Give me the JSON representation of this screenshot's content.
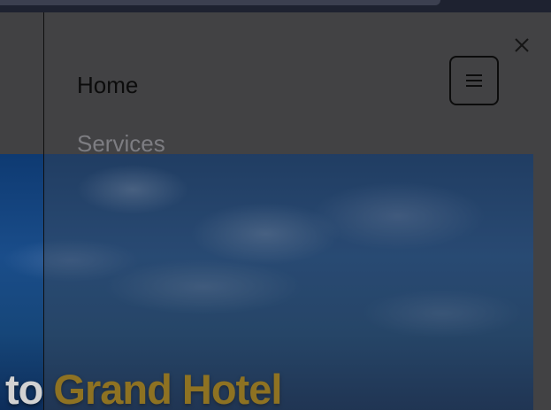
{
  "hero": {
    "title_part1": "to ",
    "title_part2": "Grand Hotel"
  },
  "drawer": {
    "nav_items": [
      {
        "label": "Home"
      },
      {
        "label": "Services"
      }
    ],
    "close_icon": "close-icon",
    "menu_icon": "hamburger-menu-icon"
  },
  "colors": {
    "accent": "#b58b0f",
    "hero_sky": "#1a4d8a"
  }
}
